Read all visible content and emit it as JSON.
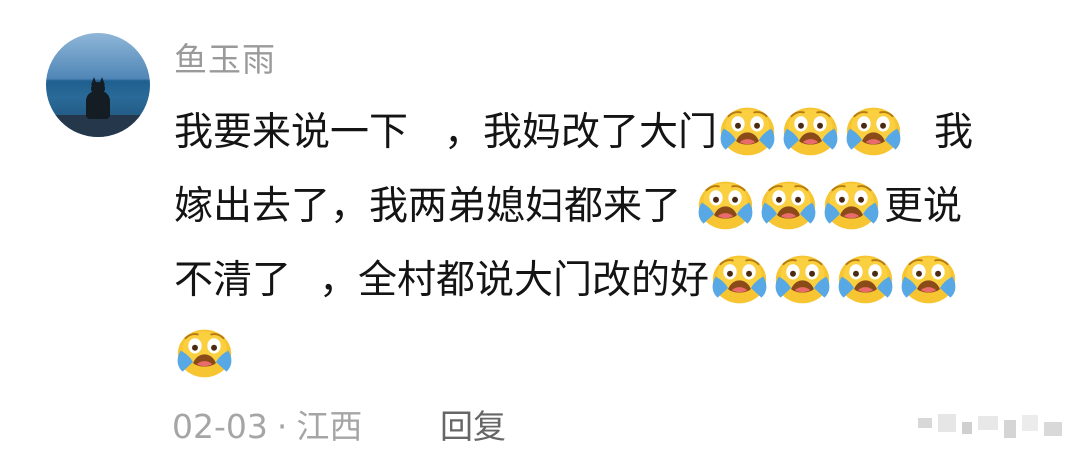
{
  "comment": {
    "user_name": "鱼玉雨",
    "lines": [
      {
        "text_a": "我要来说一下",
        "text_b": "，我妈改了大门",
        "text_c": "我"
      },
      {
        "text_a": "嫁出去了，我两弟媳妇都来了",
        "text_c": "更说"
      },
      {
        "text_a": "不清了",
        "text_b": "，全村都说大门改的好"
      }
    ],
    "emoji_icon": "loudly-crying-face-icon",
    "date": "02-03",
    "separator": "·",
    "location": "江西",
    "reply_label": "回复"
  },
  "colors": {
    "username": "#9a9a9a",
    "text": "#141414",
    "meta": "#a5a5a5",
    "reply": "#666666",
    "emoji_face": "#f7c531",
    "emoji_tears": "#58a8e5",
    "emoji_mouth": "#8a4b18"
  }
}
